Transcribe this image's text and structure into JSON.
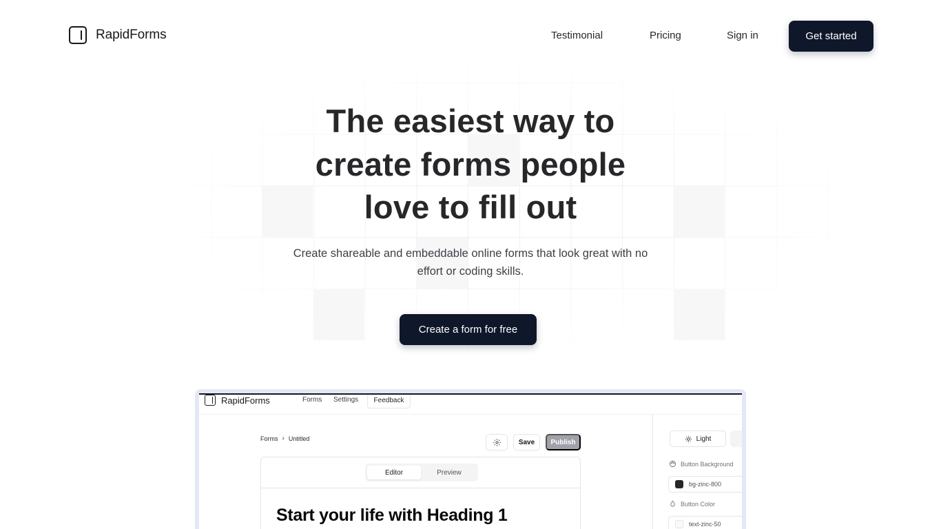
{
  "colors": {
    "primary": "#0f172a",
    "text": "#27272a",
    "swatch_zinc_800": "#27272a",
    "swatch_zinc_50": "#fafafa"
  },
  "header": {
    "brand": "RapidForms",
    "nav": [
      "Testimonial",
      "Pricing",
      "Sign in"
    ],
    "cta": "Get started"
  },
  "hero": {
    "title_lines": [
      "The easiest way to",
      "create forms people",
      "love to fill out"
    ],
    "subtitle_lines": [
      "Create shareable and embeddable online forms that look great with no",
      "effort or coding skills."
    ],
    "cta": "Create a form for free"
  },
  "preview": {
    "brand": "RapidForms",
    "nav": [
      "Forms",
      "Settings",
      "Feedback"
    ],
    "breadcrumb": [
      "Forms",
      "Untitled"
    ],
    "settings_icon": "gear-icon",
    "save": "Save",
    "publish": "Publish",
    "tabs": [
      "Editor",
      "Preview"
    ],
    "heading": "Start your life with Heading 1",
    "panel": {
      "theme": "Light",
      "button_background_label": "Button Background",
      "button_background_value": "bg-zinc-800",
      "button_color_label": "Button Color",
      "button_color_value": "text-zinc-50"
    }
  }
}
